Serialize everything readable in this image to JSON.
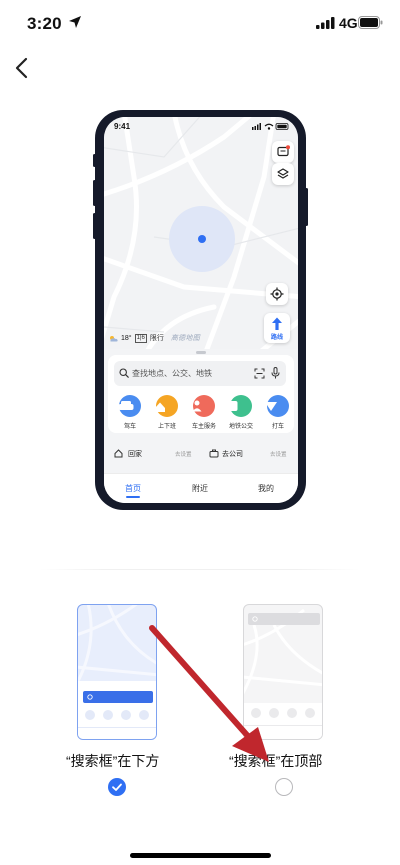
{
  "status_bar": {
    "time": "3:20",
    "network": "4G"
  },
  "phone_preview": {
    "status_time": "9:41",
    "weather": {
      "temp": "18°",
      "limit_badge": "1|6",
      "limit_text": "限行",
      "brand": "高德地图"
    },
    "route_button": "路线",
    "search_placeholder": "查找地点、公交、地铁",
    "categories": [
      {
        "label": "驾车",
        "color": "#4a8cf0",
        "icon": "car-icon"
      },
      {
        "label": "上下班",
        "color": "#f5a524",
        "icon": "home-commute-icon"
      },
      {
        "label": "车主服务",
        "color": "#ef6a5b",
        "icon": "driver-service-icon"
      },
      {
        "label": "地铁公交",
        "color": "#3ec08e",
        "icon": "subway-bus-icon"
      },
      {
        "label": "打车",
        "color": "#4a8cf0",
        "icon": "taxi-icon"
      }
    ],
    "places": [
      {
        "label": "回家",
        "status": "去设置",
        "icon": "home-icon"
      },
      {
        "label": "去公司",
        "status": "去设置",
        "icon": "briefcase-icon"
      }
    ],
    "tabs": [
      "首页",
      "附近",
      "我的"
    ],
    "active_tab": "首页"
  },
  "options": [
    {
      "label": "“搜索框”在下方",
      "selected": true
    },
    {
      "label": "“搜索框”在顶部",
      "selected": false
    }
  ],
  "colors": {
    "accent": "#2f6ff3",
    "annotation_arrow": "#c0272d"
  }
}
